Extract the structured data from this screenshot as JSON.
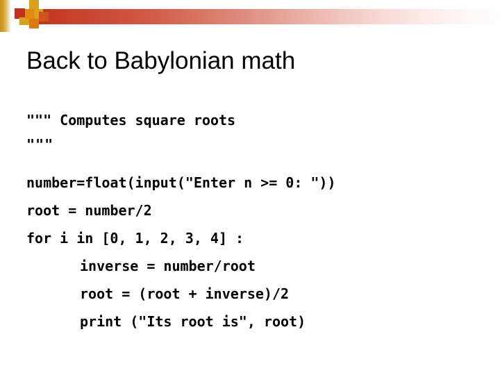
{
  "slide": {
    "title": "Back to Babylonian math",
    "decoration": {
      "bar_color_start": "#c0301c",
      "bar_color_end": "#ffffff",
      "strip_color_start": "#c8901a",
      "strip_color_end": "#ffffff",
      "square_red": "#c0301c",
      "square_gold": "#d9a11c",
      "square_orange": "#e08a14",
      "square_orange_dark": "#cf5320",
      "square_orange_low": "#db7a12"
    },
    "code": {
      "language": "python",
      "lines": [
        {
          "text": "\"\"\" Computes square roots",
          "indent": 0
        },
        {
          "text": "\"\"\"",
          "indent": 0
        },
        {
          "text": "",
          "indent": 0
        },
        {
          "text": "number=float(input(\"Enter n >= 0: \"))",
          "indent": 0
        },
        {
          "text": "root = number/2",
          "indent": 0
        },
        {
          "text": "for i in [0, 1, 2, 3, 4] :",
          "indent": 0
        },
        {
          "text": "inverse = number/root",
          "indent": 1
        },
        {
          "text": "root = (root + inverse)/2",
          "indent": 1
        },
        {
          "text": "print (\"Its root is\", root)",
          "indent": 1
        }
      ],
      "docstring_open": "\"\"\" Computes square roots",
      "docstring_close": "\"\"\"",
      "line_1": "number=float(input(\"Enter n >= 0: \"))",
      "line_2": "root = number/2",
      "line_3": "for i in [0, 1, 2, 3, 4] :",
      "line_4": "inverse = number/root",
      "line_5": "root = (root + inverse)/2",
      "line_6": "print (\"Its root is\", root)"
    }
  }
}
